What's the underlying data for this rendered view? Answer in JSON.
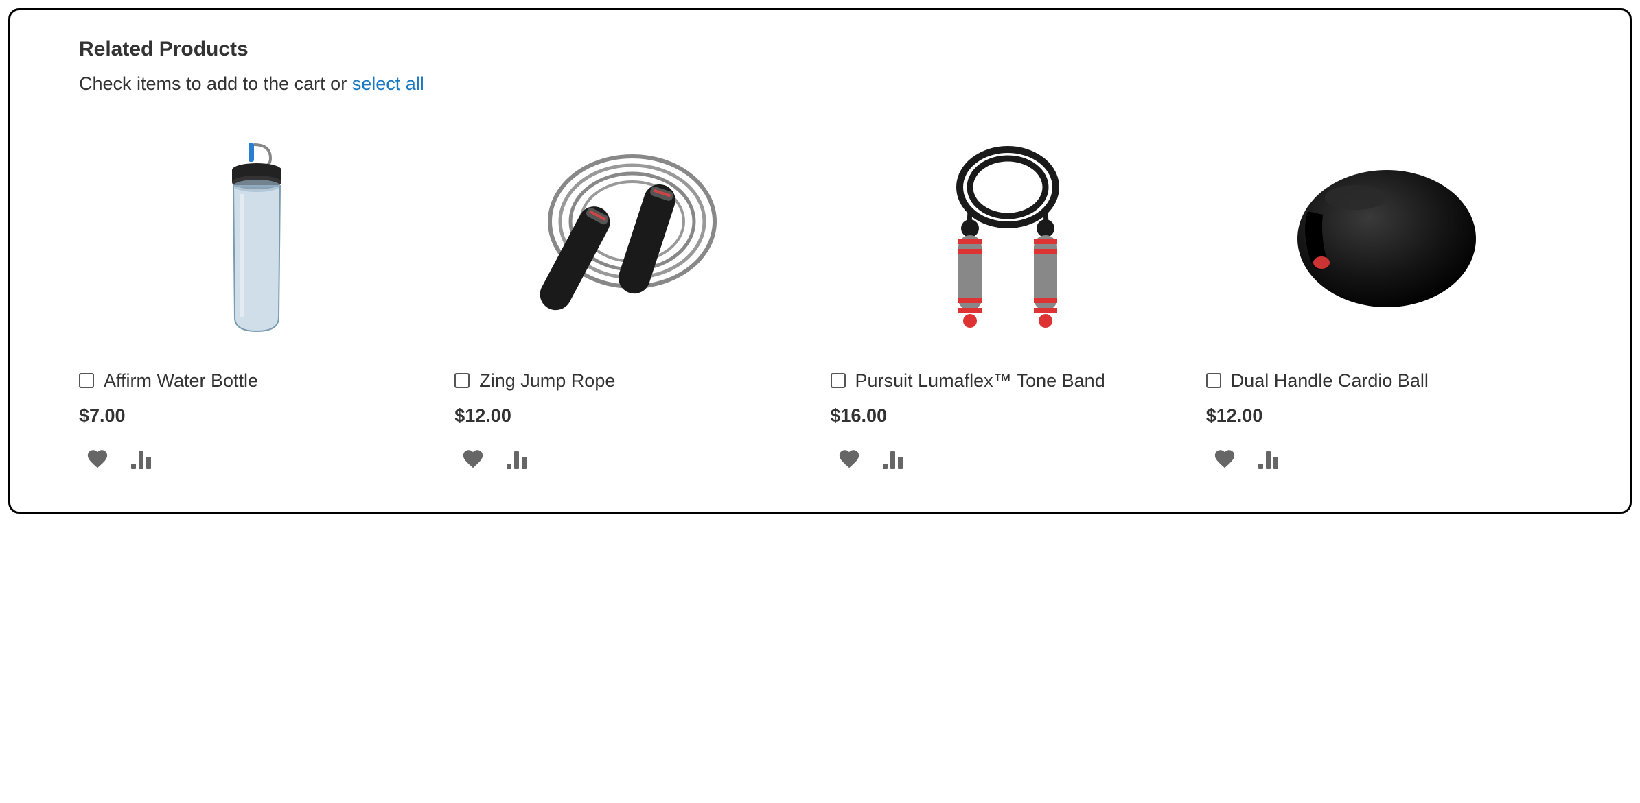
{
  "section": {
    "title": "Related Products",
    "instruction_prefix": "Check items to add to the cart or ",
    "select_all_label": "select all"
  },
  "products": [
    {
      "name": "Affirm Water Bottle",
      "price": "$7.00"
    },
    {
      "name": "Zing Jump Rope",
      "price": "$12.00"
    },
    {
      "name": "Pursuit Lumaflex™ Tone Band",
      "price": "$16.00"
    },
    {
      "name": "Dual Handle Cardio Ball",
      "price": "$12.00"
    }
  ]
}
